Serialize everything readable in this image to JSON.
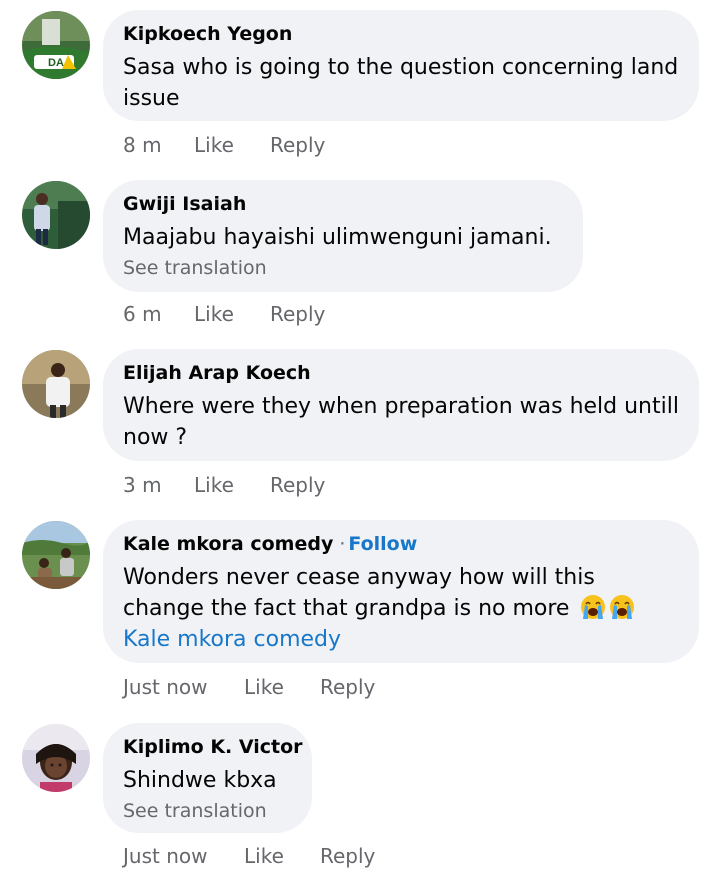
{
  "comments": [
    {
      "author": "Kipkoech Yegon",
      "text": "Sasa who is going to the question concerning land issue",
      "time": "8 m",
      "like": "Like",
      "reply": "Reply"
    },
    {
      "author": "Gwiji Isaiah",
      "text": "Maajabu hayaishi ulimwenguni jamani.",
      "see_translation": "See translation",
      "time": "6 m",
      "like": "Like",
      "reply": "Reply"
    },
    {
      "author": "Elijah Arap Koech",
      "text": "Where were they when preparation was held untill now ?",
      "time": "3 m",
      "like": "Like",
      "reply": "Reply"
    },
    {
      "author": "Kale mkora comedy",
      "separator": "·",
      "follow": "Follow",
      "text": "Wonders never cease anyway how will this change the fact that grandpa is no more",
      "emoji": "loudly-crying-face-icon",
      "tag": "Kale mkora comedy",
      "time": "Just now",
      "like": "Like",
      "reply": "Reply"
    },
    {
      "author": "Kiplimo K. Victor",
      "text": "Shindwe kbxa",
      "see_translation": "See translation",
      "time": "Just now",
      "like": "Like",
      "reply": "Reply"
    }
  ],
  "avatar_logo_text": "DA",
  "colors": {
    "bubble": "#f0f2f5",
    "link": "#1877c9",
    "meta": "#65676b",
    "text": "#050505"
  }
}
